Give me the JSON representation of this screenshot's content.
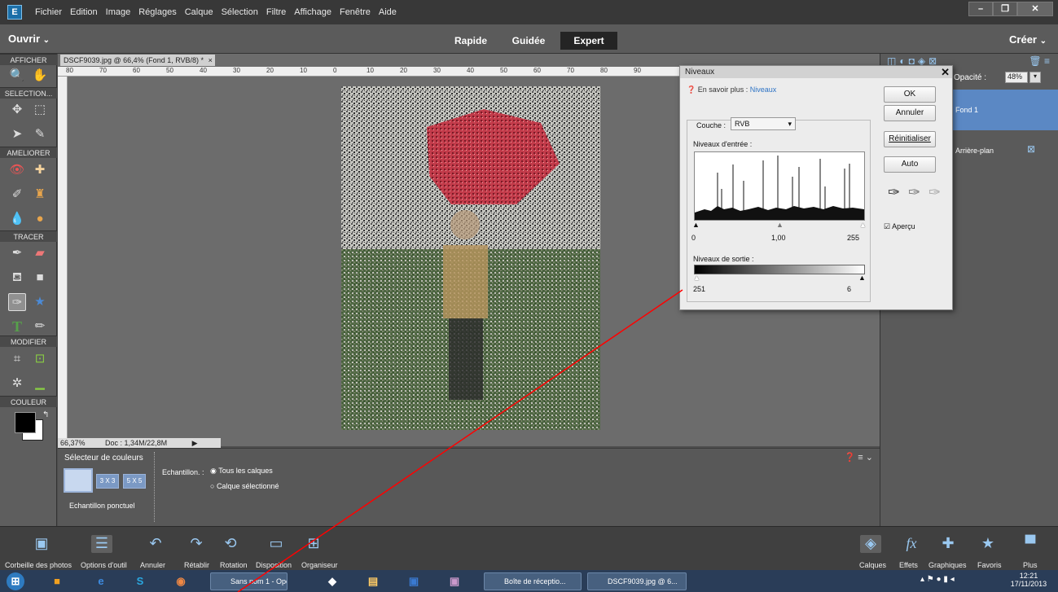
{
  "menu": [
    "Fichier",
    "Edition",
    "Image",
    "Réglages",
    "Calque",
    "Sélection",
    "Filtre",
    "Affichage",
    "Fenêtre",
    "Aide"
  ],
  "modebar": {
    "ouvrir": "Ouvrir",
    "creer": "Créer",
    "tabs": [
      "Rapide",
      "Guidée",
      "Expert"
    ],
    "active": "Expert"
  },
  "toolbox": {
    "sections": [
      "AFFICHER",
      "SELECTION...",
      "AMELIORER",
      "TRACER",
      "MODIFIER",
      "COULEUR"
    ]
  },
  "doc": {
    "tab": "DSCF9039.jpg @ 66,4% (Fond 1, RVB/8) *",
    "close": "×",
    "zoom": "66,37%",
    "size": "Doc : 1,34M/22,8M"
  },
  "rulers": {
    "h": [
      "80",
      "70",
      "60",
      "50",
      "40",
      "30",
      "20",
      "10",
      "0",
      "10",
      "20",
      "30",
      "40",
      "50",
      "60",
      "70",
      "80",
      "90"
    ]
  },
  "options": {
    "title": "Sélecteur de couleurs",
    "sample_label": "Echantillon ponctuel",
    "s3": "3 X 3",
    "s5": "5 X 5",
    "echantillon": "Echantillon. :",
    "all_layers": "Tous les calques",
    "selected_layer": "Calque sélectionné"
  },
  "dialog": {
    "title": "Niveaux",
    "learn": "En savoir plus :",
    "learn_link": "Niveaux",
    "ok": "OK",
    "cancel": "Annuler",
    "reset": "Réinitialiser",
    "auto": "Auto",
    "channel_label": "Couche :",
    "channel": "RVB",
    "input_label": "Niveaux d'entrée :",
    "in_black": "0",
    "in_mid": "1,00",
    "in_white": "255",
    "output_label": "Niveaux de sortie :",
    "out_black": "251",
    "out_white": "6",
    "preview": "Aperçu"
  },
  "layers": {
    "opacity_label": "Opacité :",
    "opacity": "48%",
    "fond": "Fond 1",
    "arriere": "Arrière-plan"
  },
  "bottombar": {
    "items": [
      "Corbeille des photos",
      "Options d'outil",
      "Annuler",
      "Rétablir",
      "Rotation",
      "Disposition",
      "Organiseur"
    ],
    "right": [
      "Calques",
      "Effets",
      "Graphiques",
      "Favoris",
      "Plus"
    ]
  },
  "taskbar": {
    "items": [
      "Sans nom 1 - Ope...",
      "Boîte de réceptio...",
      "DSCF9039.jpg @ 6..."
    ],
    "time": "12:21",
    "date": "17/11/2013"
  },
  "colors": {
    "accent": "#5b88c4",
    "red": "#ff0000"
  }
}
